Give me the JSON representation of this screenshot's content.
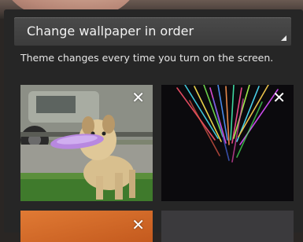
{
  "selector": {
    "label": "Change wallpaper in order"
  },
  "description": "Theme changes every time you turn on the screen.",
  "wallpapers": [
    {
      "remove_glyph": "✕",
      "icon": "dog-frisbee-photo"
    },
    {
      "remove_glyph": "✕",
      "icon": "colorful-streaks-photo"
    },
    {
      "remove_glyph": "✕",
      "icon": "orange-wallpaper"
    },
    {
      "remove_glyph": "",
      "icon": "gray-wallpaper"
    }
  ],
  "colors": {
    "panel": "#262626",
    "dropdown": "#444444",
    "text": "#f2f2f2"
  }
}
